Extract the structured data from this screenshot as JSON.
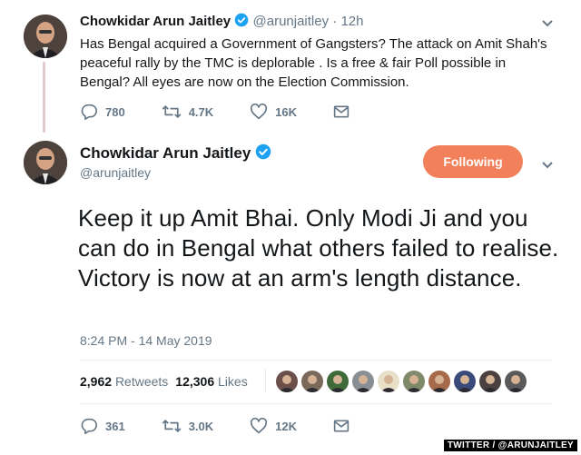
{
  "reply_tweet": {
    "name": "Chowkidar Arun Jaitley",
    "handle": "@arunjaitley",
    "time": "· 12h",
    "text": "Has Bengal acquired a Government of Gangsters? The attack on Amit Shah's peaceful rally by the TMC is deplorable . Is a free & fair Poll possible in Bengal? All eyes are now on the Election Commission.",
    "actions": {
      "replies": "780",
      "retweets": "4.7K",
      "likes": "16K"
    }
  },
  "main_tweet": {
    "name": "Chowkidar Arun Jaitley",
    "handle": "@arunjaitley",
    "follow_label": "Following",
    "text": "Keep it up Amit Bhai. Only Modi Ji and you can do in Bengal what others failed to realise. Victory is now at an arm's length distance.",
    "timestamp": "8:24 PM - 14 May 2019",
    "retweets_count": "2,962",
    "retweets_label": "Retweets",
    "likes_count": "12,306",
    "likes_label": "Likes",
    "actions": {
      "replies": "361",
      "retweets": "3.0K",
      "likes": "12K"
    }
  },
  "liker_avatar_colors": [
    "#6b4f4a",
    "#7a6a5c",
    "#3f6b3a",
    "#8a8f95",
    "#e8e0c8",
    "#7f8a6a",
    "#a56a4a",
    "#3a4a7a",
    "#4a4040",
    "#5a5a5a"
  ],
  "watermark": "TWITTER / @ARUNJAITLEY",
  "colors": {
    "accent": "#f2805a",
    "verified": "#1da1f2",
    "thread": "#e1c8cb"
  },
  "icons": [
    "reply-icon",
    "retweet-icon",
    "like-icon",
    "message-icon",
    "verified-icon",
    "chevron-down-icon"
  ]
}
